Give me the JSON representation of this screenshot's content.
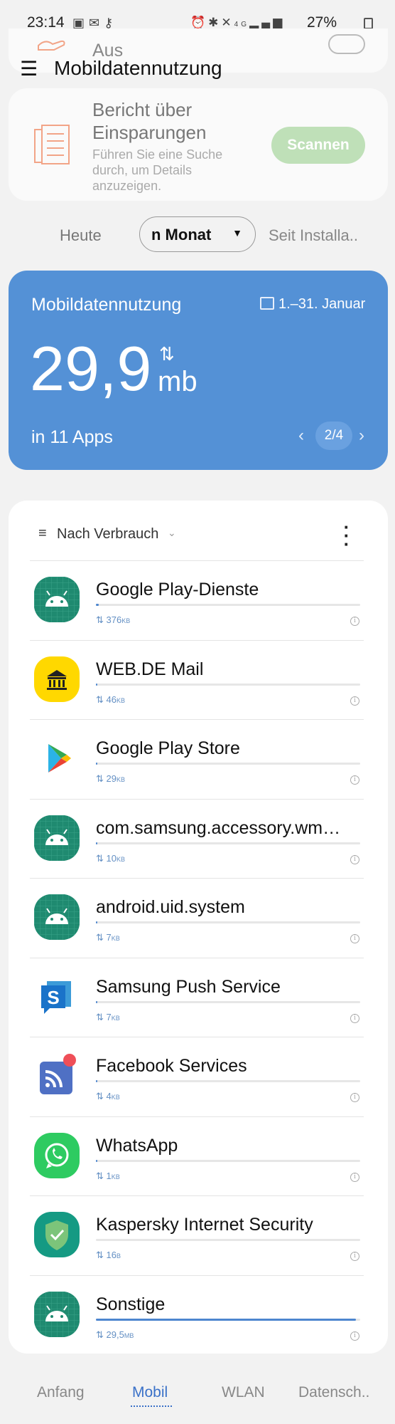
{
  "status_bar": {
    "time": "23:14",
    "left_icons": [
      "image-icon",
      "mail-icon",
      "key-icon"
    ],
    "right_icons": [
      "alarm-icon",
      "bluetooth-icon",
      "mute-icon",
      "4g-icon",
      "signal-icon"
    ],
    "network_label": "4G",
    "battery": "27%"
  },
  "header": {
    "menu_icon": "hamburger-icon",
    "title": "Mobildatennutzung",
    "partial_setting_label": "Aus"
  },
  "savings_card": {
    "title": "Bericht über Einsparungen",
    "subtitle": "Führen Sie eine Suche durch, um Details anzuzeigen.",
    "scan_button": "Scannen",
    "accent_color": "#f2a487"
  },
  "period_selector": {
    "left": "Heute",
    "selected": "n Monat",
    "right": "Seit Installa.."
  },
  "usage_card": {
    "title": "Mobildatennutzung",
    "date_range": "1.–31. Januar",
    "amount": "29,9",
    "unit": "mb",
    "apps_count": "in 11 Apps",
    "page": "2/4",
    "color": "#5491d6"
  },
  "list": {
    "sort_label": "Nach Verbrauch",
    "apps": [
      {
        "name": "Google Play-Dienste",
        "size": "376",
        "unit": "KB",
        "fraction": 0.012,
        "icon": "android-icon"
      },
      {
        "name": "WEB.DE Mail",
        "size": "46",
        "unit": "KB",
        "fraction": 0.0015,
        "icon": "webde-icon"
      },
      {
        "name": "Google Play Store",
        "size": "29",
        "unit": "KB",
        "fraction": 0.001,
        "icon": "play-store-icon"
      },
      {
        "name": "com.samsung.accessory.wm…",
        "size": "10",
        "unit": "KB",
        "fraction": 0.0005,
        "icon": "android-icon"
      },
      {
        "name": "android.uid.system",
        "size": "7",
        "unit": "KB",
        "fraction": 0.0003,
        "icon": "android-icon"
      },
      {
        "name": "Samsung Push Service",
        "size": "7",
        "unit": "KB",
        "fraction": 0.0003,
        "icon": "samsung-push-icon"
      },
      {
        "name": "Facebook Services",
        "size": "4",
        "unit": "KB",
        "fraction": 0.0002,
        "icon": "facebook-services-icon"
      },
      {
        "name": "WhatsApp",
        "size": "1",
        "unit": "KB",
        "fraction": 0.0001,
        "icon": "whatsapp-icon"
      },
      {
        "name": "Kaspersky Internet Security",
        "size": "16",
        "unit": "B",
        "fraction": 0.0,
        "icon": "kaspersky-icon"
      },
      {
        "name": "Sonstige",
        "size": "29,5",
        "unit": "MB",
        "fraction": 0.985,
        "icon": "android-icon"
      }
    ]
  },
  "bottom_nav": {
    "items": [
      "Anfang",
      "Mobil",
      "WLAN",
      "Datensch.."
    ],
    "active": "Mobil"
  }
}
